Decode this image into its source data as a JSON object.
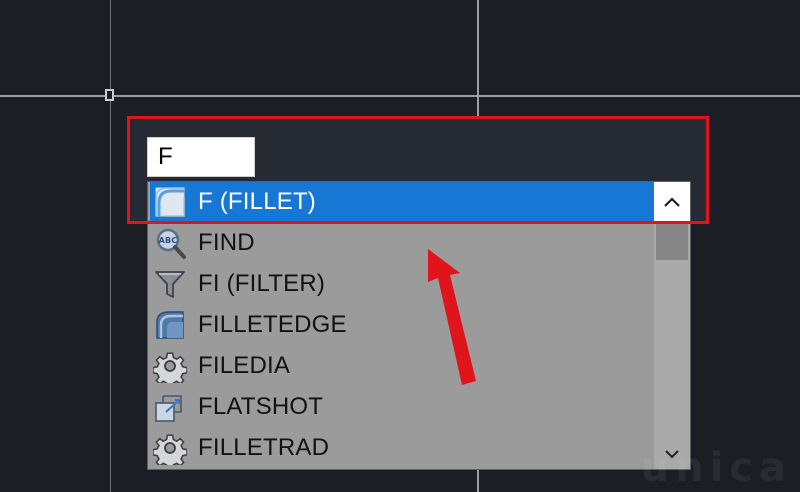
{
  "command_line": {
    "input_value": "F"
  },
  "autocomplete": {
    "selected_index": 0,
    "items": [
      {
        "label": "F (FILLET)",
        "icon": "fillet-icon"
      },
      {
        "label": "FIND",
        "icon": "find-text-icon"
      },
      {
        "label": "FI (FILTER)",
        "icon": "filter-funnel-icon"
      },
      {
        "label": "FILLETEDGE",
        "icon": "filletedge-icon"
      },
      {
        "label": "FILEDIA",
        "icon": "gear-icon"
      },
      {
        "label": "FLATSHOT",
        "icon": "flatshot-icon"
      },
      {
        "label": "FILLETRAD",
        "icon": "gear-icon"
      }
    ]
  },
  "watermark": {
    "text": "unica"
  },
  "colors": {
    "drawing_background": "#1b1e25",
    "selection": "#1677d4",
    "highlight_frame": "#e0141b",
    "arrow": "#e0141b",
    "list_background": "#9b9b9b"
  }
}
